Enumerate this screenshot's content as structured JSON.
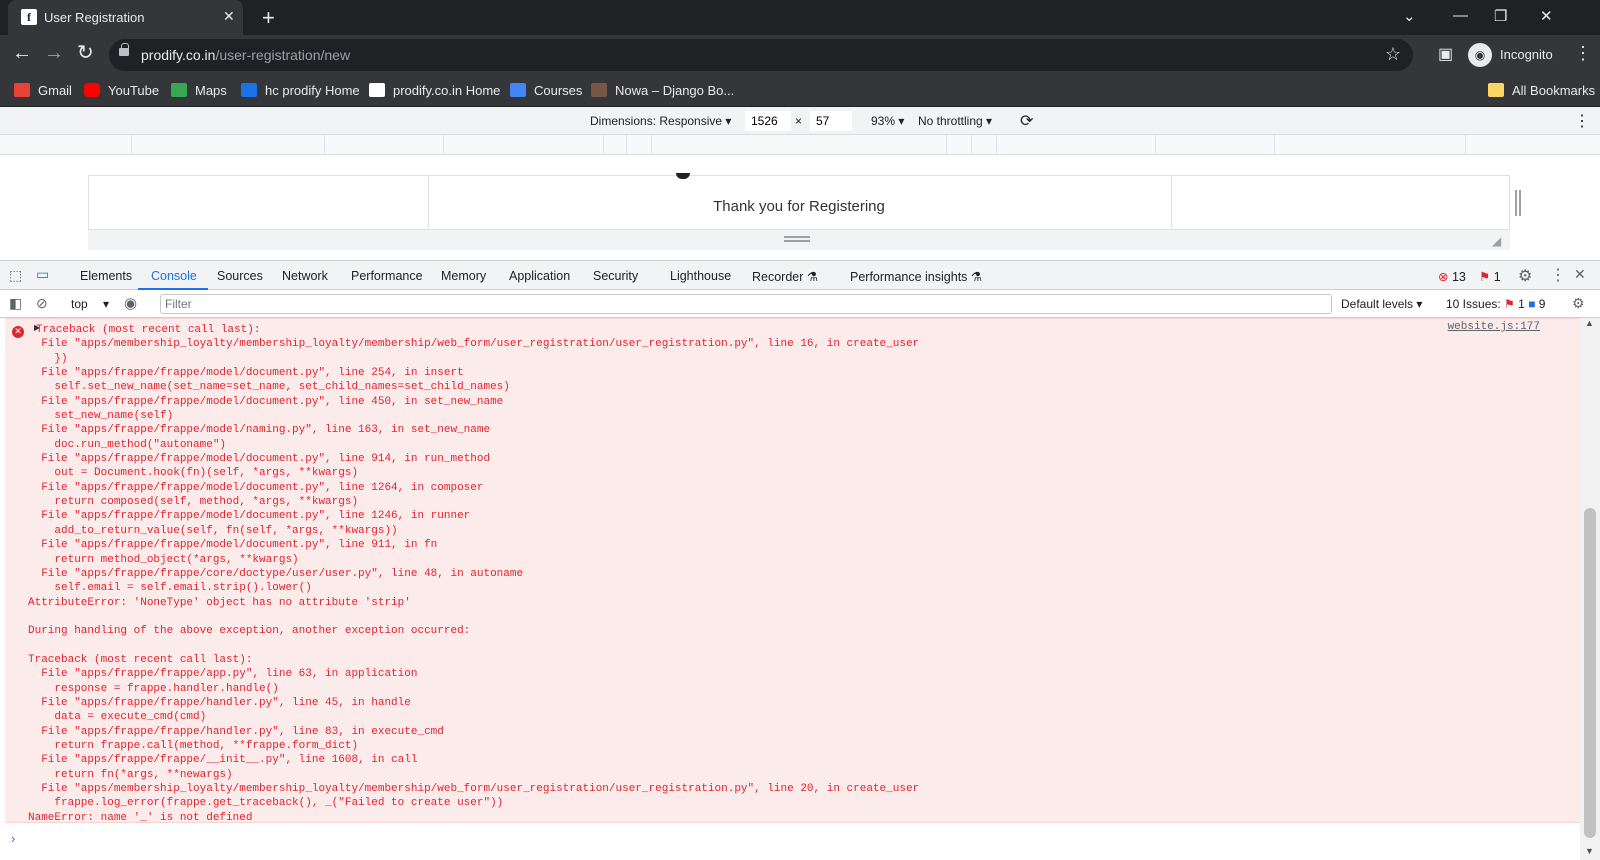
{
  "tab": {
    "title": "User Registration",
    "favicon_letter": "f"
  },
  "toolbar": {
    "url_host": "prodify.co.in",
    "url_path": "/user-registration/new",
    "profile_label": "Incognito"
  },
  "bookmarks": [
    {
      "label": "Gmail",
      "color": "#ea4335"
    },
    {
      "label": "YouTube",
      "color": "#ff0000"
    },
    {
      "label": "Maps",
      "color": "#34a853"
    },
    {
      "label": "hc prodify Home",
      "color": "#1a73e8"
    },
    {
      "label": "prodify.co.in Home",
      "color": "#ffffff"
    },
    {
      "label": "Courses",
      "color": "#4285f4"
    },
    {
      "label": "Nowa – Django Bo...",
      "color": "#795548"
    }
  ],
  "all_bookmarks": "All Bookmarks",
  "device_toolbar": {
    "dimensions": "Dimensions: Responsive",
    "width": "1526",
    "times": "×",
    "height": "57",
    "zoom": "93%",
    "throttling": "No throttling"
  },
  "viewport": {
    "message": "Thank you for Registering"
  },
  "devtools": {
    "tabs": [
      "Elements",
      "Console",
      "Sources",
      "Network",
      "Performance",
      "Memory",
      "Application",
      "Security",
      "Lighthouse",
      "Recorder",
      "Performance insights"
    ],
    "error_count": "13",
    "warning_count": "1",
    "context": "top",
    "filter_placeholder": "Filter",
    "levels": "Default levels",
    "issues_label": "10 Issues:",
    "issues_errors": "1",
    "issues_info": "9"
  },
  "console": {
    "source": "website.js:177",
    "lines": [
      "Traceback (most recent call last):",
      "  File \"apps/membership_loyalty/membership_loyalty/membership/web_form/user_registration/user_registration.py\", line 16, in create_user",
      "    })",
      "  File \"apps/frappe/frappe/model/document.py\", line 254, in insert",
      "    self.set_new_name(set_name=set_name, set_child_names=set_child_names)",
      "  File \"apps/frappe/frappe/model/document.py\", line 450, in set_new_name",
      "    set_new_name(self)",
      "  File \"apps/frappe/frappe/model/naming.py\", line 163, in set_new_name",
      "    doc.run_method(\"autoname\")",
      "  File \"apps/frappe/frappe/model/document.py\", line 914, in run_method",
      "    out = Document.hook(fn)(self, *args, **kwargs)",
      "  File \"apps/frappe/frappe/model/document.py\", line 1264, in composer",
      "    return composed(self, method, *args, **kwargs)",
      "  File \"apps/frappe/frappe/model/document.py\", line 1246, in runner",
      "    add_to_return_value(self, fn(self, *args, **kwargs))",
      "  File \"apps/frappe/frappe/model/document.py\", line 911, in fn",
      "    return method_object(*args, **kwargs)",
      "  File \"apps/frappe/frappe/core/doctype/user/user.py\", line 48, in autoname",
      "    self.email = self.email.strip().lower()",
      "AttributeError: 'NoneType' object has no attribute 'strip'",
      "",
      "During handling of the above exception, another exception occurred:",
      "",
      "Traceback (most recent call last):",
      "  File \"apps/frappe/frappe/app.py\", line 63, in application",
      "    response = frappe.handler.handle()",
      "  File \"apps/frappe/frappe/handler.py\", line 45, in handle",
      "    data = execute_cmd(cmd)",
      "  File \"apps/frappe/frappe/handler.py\", line 83, in execute_cmd",
      "    return frappe.call(method, **frappe.form_dict)",
      "  File \"apps/frappe/frappe/__init__.py\", line 1608, in call",
      "    return fn(*args, **newargs)",
      "  File \"apps/membership_loyalty/membership_loyalty/membership/web_form/user_registration/user_registration.py\", line 20, in create_user",
      "    frappe.log_error(frappe.get_traceback(), _(\"Failed to create user\"))",
      "NameError: name '_' is not defined"
    ]
  }
}
